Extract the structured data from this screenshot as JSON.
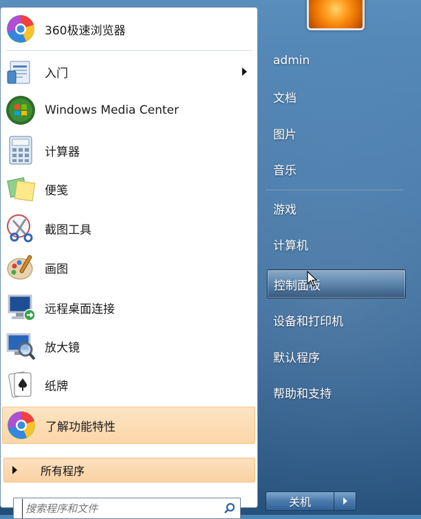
{
  "pinned": [
    {
      "label": "360极速浏览器",
      "icon": "chrome-360-icon"
    },
    {
      "label": "入门",
      "icon": "getting-started-icon",
      "has_submenu": true
    },
    {
      "label": "Windows Media Center",
      "icon": "windows-media-center-icon"
    },
    {
      "label": "计算器",
      "icon": "calculator-icon"
    },
    {
      "label": "便笺",
      "icon": "sticky-notes-icon"
    },
    {
      "label": "截图工具",
      "icon": "scissors-icon"
    },
    {
      "label": "画图",
      "icon": "paint-palette-icon"
    },
    {
      "label": "远程桌面连接",
      "icon": "remote-desktop-icon"
    },
    {
      "label": "放大镜",
      "icon": "magnifier-icon"
    },
    {
      "label": "纸牌",
      "icon": "cards-icon"
    },
    {
      "label": "了解功能特性",
      "icon": "chrome-360-icon"
    }
  ],
  "all_programs_label": "所有程序",
  "search": {
    "placeholder": "搜索程序和文件"
  },
  "right": {
    "user": "admin",
    "items": [
      "文档",
      "图片",
      "音乐",
      "游戏",
      "计算机",
      "控制面板",
      "设备和打印机",
      "默认程序",
      "帮助和支持"
    ],
    "highlighted": "控制面板"
  },
  "shutdown_label": "关机",
  "colors": {
    "accent": "#fbd6a8",
    "taskbar_blue": "#3f75a8"
  }
}
